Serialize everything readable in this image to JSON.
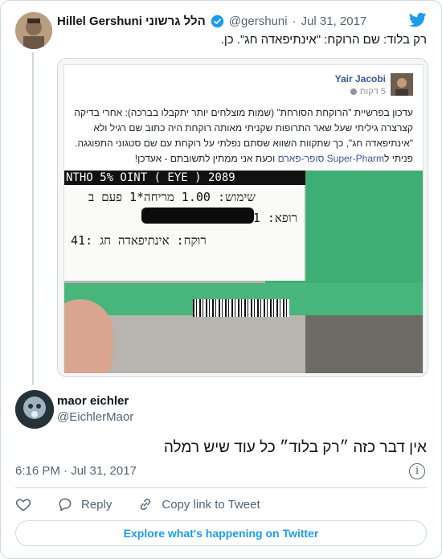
{
  "parent_tweet": {
    "display_name": "Hillel Gershuni הלל גרשוני",
    "handle": "@gershuni",
    "separator": "·",
    "date": "Jul 31, 2017",
    "text": "רק בלוד: שם הרוקח: \"אינתיפאדה חג\". כן."
  },
  "embedded_post": {
    "author": "Yair Jacobi",
    "time": "5 דקות",
    "text_before_link": "עדכון בפרשיית \"הרוקחת הסורחת\" (שמות מוצלחים יותר יתקבלו בברכה): אחרי בדיקה קצרצרה גיליתי שעל שאר התרופות שקניתי מאותה רוקחת היה כתוב שם רגיל ולא \"אינתיפאדה חג\", כך שתקוות השווא שסתם נפלתי על רוקחת עם שם סטגוני התפוגגה. פניתי ל",
    "link_text": "Super-Pharm סופר-פארם",
    "text_after_link": " וכעת אני ממתין לתשובתם - אעדכן!",
    "label_lines": [
      "NTHO 5% OINT ( EYE ) 2089",
      "שימוש: 1.00 מריחה*1 פעם ב",
      "רופא: 1",
      "רוקח: אינתיפאדה חג  :41"
    ]
  },
  "reply_tweet": {
    "display_name": "maor eichler",
    "handle": "@EichlerMaor",
    "text": "אין דבר כזה ״רק בלוד״ כל עוד שיש רמלה",
    "timestamp": "6:16 PM · Jul 31, 2017"
  },
  "actions": {
    "reply": "Reply",
    "copy_link": "Copy link to Tweet"
  },
  "footer": {
    "explore": "Explore what's happening on Twitter"
  },
  "colors": {
    "twitter_blue": "#1d9bf0",
    "verified": "#1d9bf0",
    "secondary_text": "#536471",
    "fb_link": "#385898"
  }
}
